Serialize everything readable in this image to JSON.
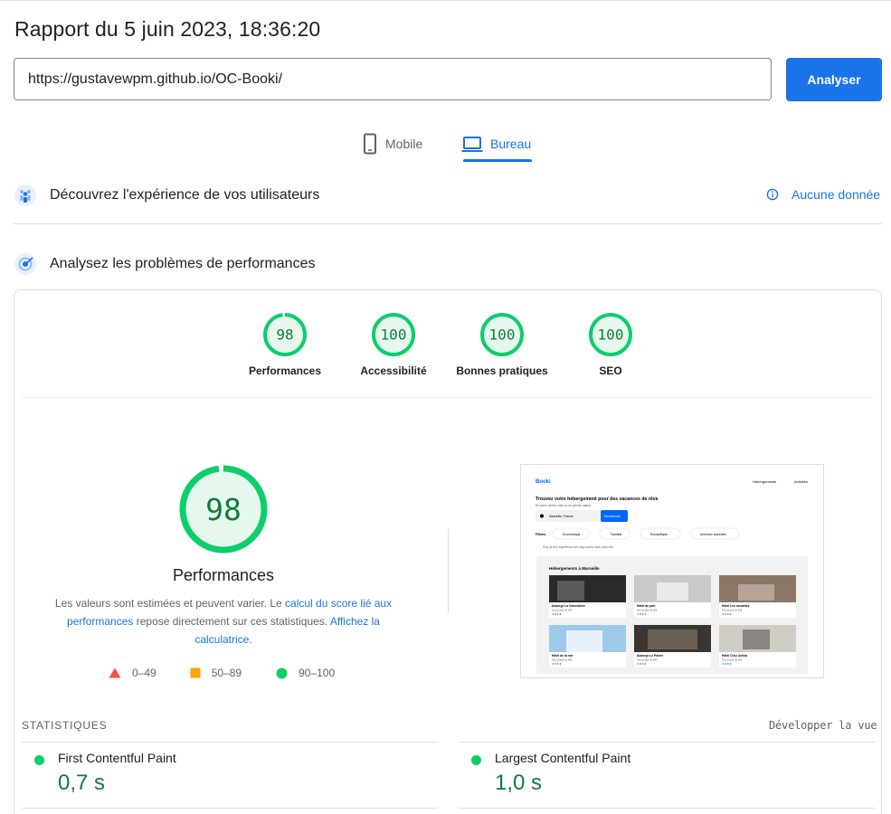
{
  "report": {
    "title": "Rapport du 5 juin 2023, 18:36:20",
    "url": "https://gustavewpm.github.io/OC-Booki/",
    "analyze_label": "Analyser"
  },
  "device_tabs": [
    {
      "label": "Mobile",
      "icon": "phone-icon",
      "active": false
    },
    {
      "label": "Bureau",
      "icon": "laptop-icon",
      "active": true
    }
  ],
  "sections": {
    "users": {
      "title": "Découvrez l'expérience de vos utilisateurs",
      "status": "Aucune donnée"
    },
    "performance": {
      "title": "Analysez les problèmes de performances"
    }
  },
  "categories": [
    {
      "label": "Performances",
      "score": "98",
      "value": 98
    },
    {
      "label": "Accessibilité",
      "score": "100",
      "value": 100
    },
    {
      "label": "Bonnes pratiques",
      "score": "100",
      "value": 100
    },
    {
      "label": "SEO",
      "score": "100",
      "value": 100
    }
  ],
  "main_score": {
    "value": 98,
    "score": "98",
    "label": "Performances",
    "desc_part1": "Les valeurs sont estimées et peuvent varier. Le ",
    "desc_link1": "calcul du score lié aux performances",
    "desc_part2": " repose directement sur ces statistiques. ",
    "desc_link2": "Affichez la calculatrice.",
    "desc_part3": ""
  },
  "legend": [
    {
      "range": "0–49",
      "shape": "triangle",
      "color": "#ff4e42"
    },
    {
      "range": "50–89",
      "shape": "square",
      "color": "#ffa400"
    },
    {
      "range": "90–100",
      "shape": "circle",
      "color": "#0cce6b"
    }
  ],
  "thumbnail": {
    "logo": "Booki",
    "nav": [
      "Hébergements",
      "Activités"
    ],
    "headline": "Trouvez votre hébergement pour des vacances de rêve",
    "subline": "En plein centre-ville ou en pleine nature",
    "location": "Marseille, France",
    "search_btn": "Rechercher",
    "filters_label": "Filtres",
    "filters": [
      "Économique",
      "Familial",
      "Romantique",
      "Animaux autorisés"
    ],
    "info": "Plus de 500 logements sont disponibles dans cette ville",
    "section_title": "Hébergements à Marseille",
    "cards": [
      "Auberge La Cannebière",
      "Hôtel du port",
      "Hôtel Les mouettes",
      "Hôtel de la mer",
      "Auberge Le Panier",
      "Hôtel Chez Amina"
    ],
    "card_sub": "Nuit à partir de 25€"
  },
  "stats": {
    "title": "STATISTIQUES",
    "expand_label": "Développer la vue",
    "metrics": [
      {
        "name": "First Contentful Paint",
        "value": "0,7 s"
      },
      {
        "name": "Largest Contentful Paint",
        "value": "1,0 s"
      }
    ]
  },
  "colors": {
    "accent": "#1a73e8",
    "pass": "#0cce6b",
    "pass_text": "#0f7c3a",
    "gauge_bg": "#e6f8ed"
  }
}
